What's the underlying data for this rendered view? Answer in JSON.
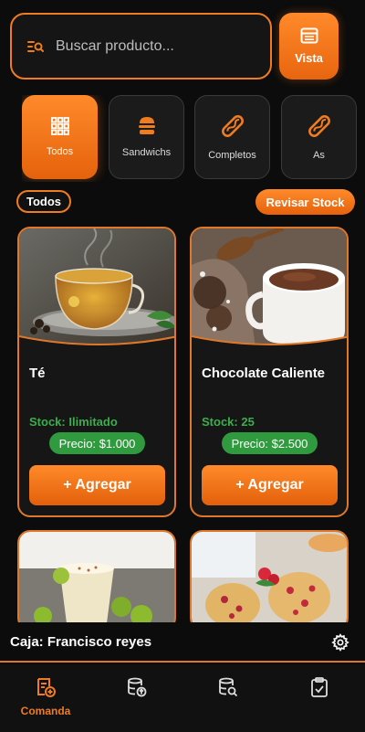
{
  "search": {
    "placeholder": "Buscar producto..."
  },
  "view_button": {
    "label": "Vista"
  },
  "categories": [
    {
      "label": "Todos",
      "icon": "grid-icon",
      "active": true
    },
    {
      "label": "Sandwichs",
      "icon": "burger-icon",
      "active": false
    },
    {
      "label": "Completos",
      "icon": "hotdog-icon",
      "active": false
    },
    {
      "label": "As",
      "icon": "hotdog-icon",
      "active": false
    }
  ],
  "filter": {
    "active_label": "Todos"
  },
  "stock_button": {
    "label": "Revisar Stock"
  },
  "products": [
    {
      "name": "Té",
      "stock": "Stock: Ilimitado",
      "price": "Precio: $1.000",
      "add_label": "+ Agregar",
      "image": "tea-cup"
    },
    {
      "name": "Chocolate Caliente",
      "stock": "Stock: 25",
      "price": "Precio: $2.500",
      "add_label": "+ Agregar",
      "image": "hot-chocolate"
    },
    {
      "image": "pisco-sour"
    },
    {
      "image": "muffins"
    }
  ],
  "cashier": {
    "label": "Caja: Francisco reyes"
  },
  "nav": [
    {
      "label": "Comanda",
      "icon": "order-icon",
      "active": true
    },
    {
      "label": "",
      "icon": "database-upload-icon",
      "active": false
    },
    {
      "label": "",
      "icon": "database-search-icon",
      "active": false
    },
    {
      "label": "",
      "icon": "clipboard-check-icon",
      "active": false
    }
  ],
  "colors": {
    "accent": "#f07c20",
    "stock_green": "#3cae4b",
    "price_green": "#2f9b3e",
    "background": "#0c0c0c"
  }
}
